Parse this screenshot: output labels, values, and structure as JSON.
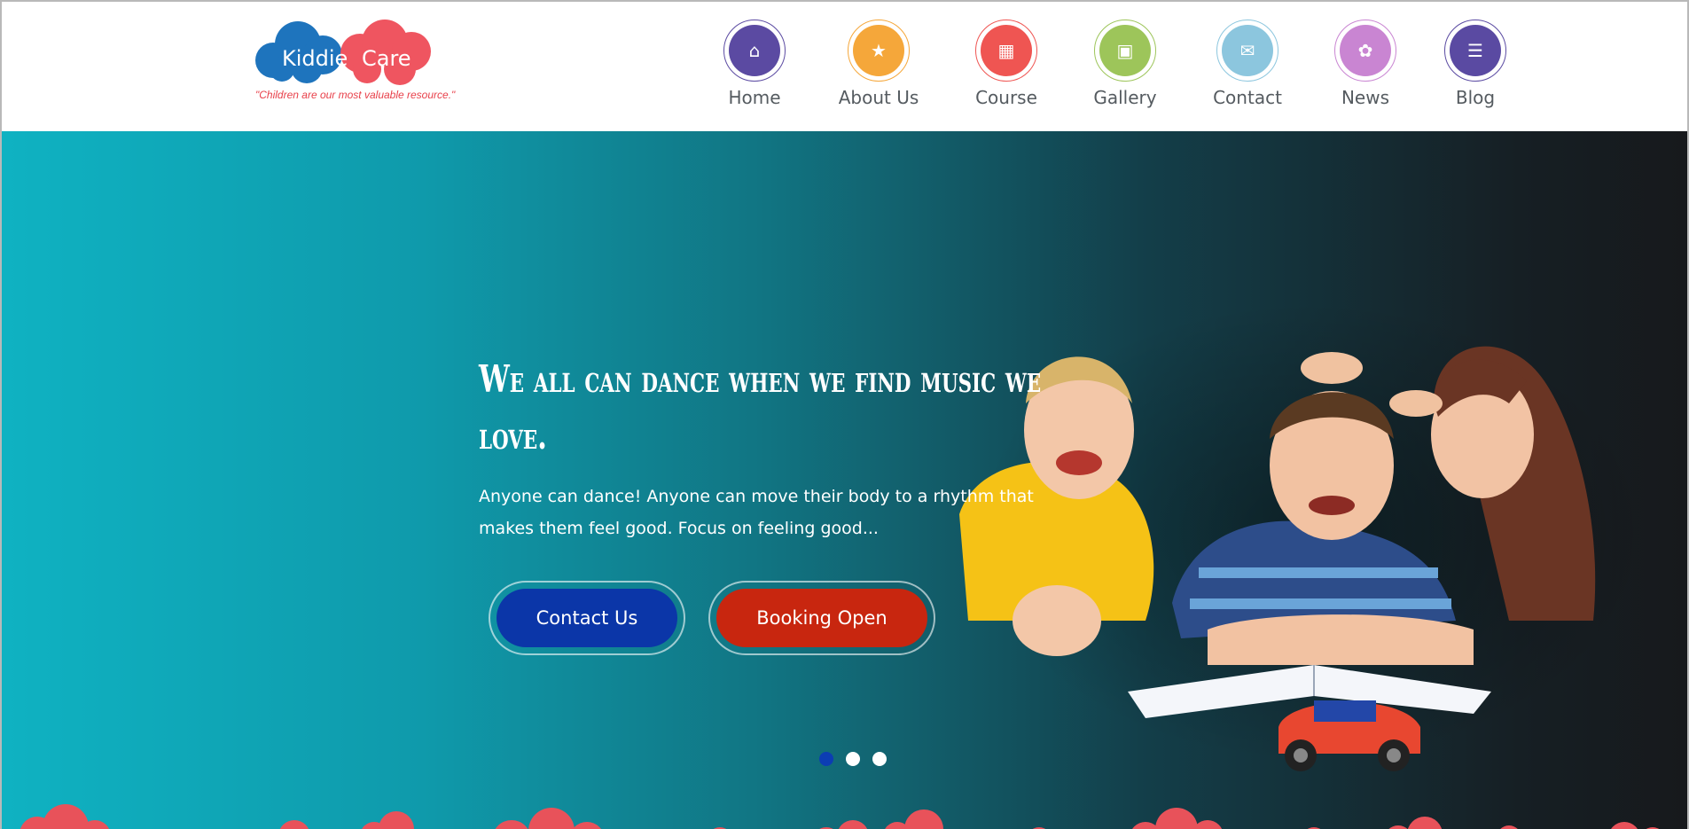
{
  "logo": {
    "word1": "Kiddie",
    "word2": "Care",
    "tagline": "\"Children are our most valuable resource.\""
  },
  "nav": {
    "items": [
      {
        "label": "Home",
        "icon": "home-icon",
        "color": "#5b4aa2"
      },
      {
        "label": "About Us",
        "icon": "star-icon",
        "color": "#f5a73a"
      },
      {
        "label": "Course",
        "icon": "cubes-icon",
        "color": "#ef5552"
      },
      {
        "label": "Gallery",
        "icon": "image-icon",
        "color": "#9dc55a"
      },
      {
        "label": "Contact",
        "icon": "envelope-icon",
        "color": "#8cc6de"
      },
      {
        "label": "News",
        "icon": "leaf-icon",
        "color": "#c985d2"
      },
      {
        "label": "Blog",
        "icon": "database-icon",
        "color": "#5a4aa2"
      }
    ]
  },
  "hero": {
    "title": "We all can dance when we find music we love.",
    "text": "Anyone can dance! Anyone can move their body to a rhythm that makes them feel good. Focus on feeling good...",
    "contact_button": "Contact Us",
    "booking_button": "Booking Open",
    "slides": 3,
    "active_slide": 1
  },
  "colors": {
    "contact_button": "#0b36a8",
    "booking_button": "#c8260f",
    "active_dot": "#0c3db3",
    "cloud": "#e8525a"
  }
}
